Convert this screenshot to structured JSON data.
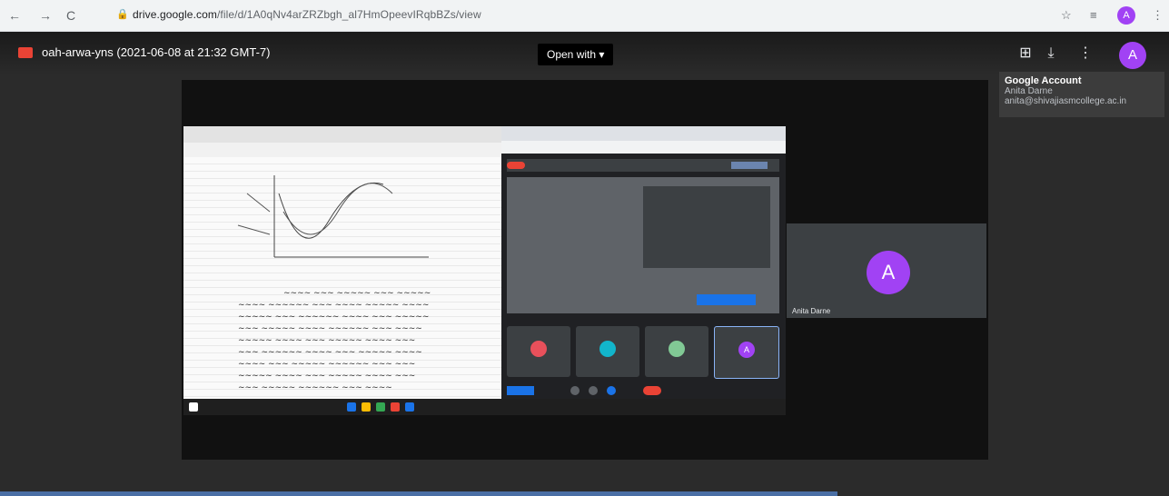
{
  "browser": {
    "url_domain": "drive.google.com",
    "url_path": "/file/d/1A0qNv4arZRZbgh_al7HmOpeevIRqbBZs/view",
    "avatar_letter": "A"
  },
  "viewer": {
    "file_title": "oah-arwa-yns (2021-06-08 at 21:32 GMT-7)",
    "open_with_label": "Open with ▾",
    "avatar_letter": "A"
  },
  "account_tooltip": {
    "title": "Google Account",
    "name": "Anita Darne",
    "email": "anita@shivajiasmcollege.ac.in"
  },
  "participant": {
    "avatar_letter": "A",
    "name": "Anita Darne"
  },
  "meet": {
    "tile_letters": [
      "",
      "",
      "",
      "A"
    ]
  },
  "colors": {
    "accent_purple": "#a142f4",
    "record_red": "#ea4335",
    "meet_blue": "#1a73e8"
  }
}
